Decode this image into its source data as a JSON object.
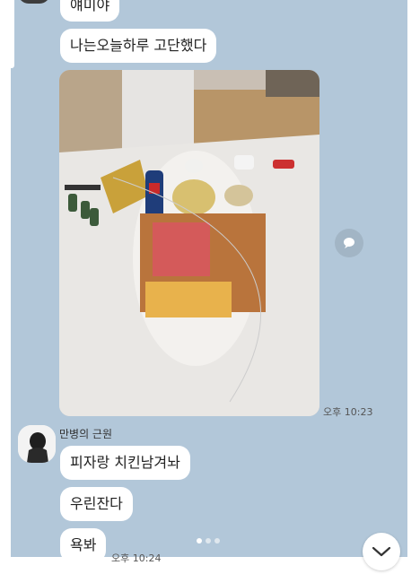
{
  "messages": {
    "top_partial": "얘미야",
    "msg1": "나는오늘하루 고단했다",
    "photo_time": "오후 10:23",
    "sender_name": "만병의 근원",
    "msg2": "피자랑 치킨남겨놔",
    "msg3": "우린잔다",
    "msg4": "욕봐",
    "bottom_time": "오후 10:24"
  },
  "icons": {
    "share": "share-icon",
    "scroll_down": "chevron-down-icon"
  },
  "colors": {
    "chat_background": "#b2c7d9",
    "bubble": "#ffffff"
  }
}
